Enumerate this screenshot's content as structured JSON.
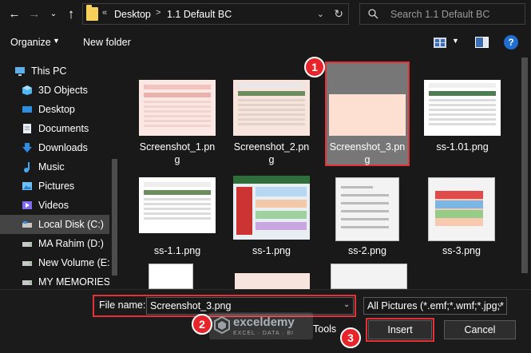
{
  "address": {
    "crumbs": [
      "Desktop",
      "1.1 Default BC"
    ],
    "overflow": "«",
    "search_placeholder": "Search 1.1 Default BC"
  },
  "toolbar": {
    "organize": "Organize",
    "new_folder": "New folder",
    "help": "?"
  },
  "sidebar": {
    "items": [
      {
        "label": "This PC",
        "icon": "monitor-icon"
      },
      {
        "label": "3D Objects",
        "icon": "cube-icon"
      },
      {
        "label": "Desktop",
        "icon": "desktop-icon"
      },
      {
        "label": "Documents",
        "icon": "document-icon"
      },
      {
        "label": "Downloads",
        "icon": "download-icon"
      },
      {
        "label": "Music",
        "icon": "music-icon"
      },
      {
        "label": "Pictures",
        "icon": "pictures-icon"
      },
      {
        "label": "Videos",
        "icon": "video-icon"
      },
      {
        "label": "Local Disk (C:)",
        "icon": "drive-icon",
        "selected": true
      },
      {
        "label": "MA Rahim (D:)",
        "icon": "drive-icon"
      },
      {
        "label": "New Volume (E:)",
        "icon": "drive-icon"
      },
      {
        "label": "MY MEMORIES (",
        "icon": "drive-icon"
      }
    ]
  },
  "files": [
    {
      "line1": "Screenshot_1.pn",
      "line2": "g"
    },
    {
      "line1": "Screenshot_2.pn",
      "line2": "g"
    },
    {
      "line1": "Screenshot_3.pn",
      "line2": "g",
      "selected": true
    },
    {
      "line1": "ss-1.01.png",
      "line2": ""
    },
    {
      "line1": "ss-1.1.png",
      "line2": ""
    },
    {
      "line1": "ss-1.png",
      "line2": ""
    },
    {
      "line1": "ss-2.png",
      "line2": ""
    },
    {
      "line1": "ss-3.png",
      "line2": ""
    }
  ],
  "bottom": {
    "file_name_label": "File name:",
    "file_name_value": "Screenshot_3.png",
    "file_type": "All Pictures (*.emf;*.wmf;*.jpg;*",
    "tools": "Tools",
    "insert": "Insert",
    "cancel": "Cancel"
  },
  "callouts": [
    "1",
    "2",
    "3"
  ],
  "watermark": {
    "name": "exceldemy",
    "tagline": "EXCEL · DATA · BI"
  },
  "colors": {
    "background": "#191919",
    "highlight": "#e23237",
    "selection": "#777777",
    "folder": "#f7cf5b"
  }
}
